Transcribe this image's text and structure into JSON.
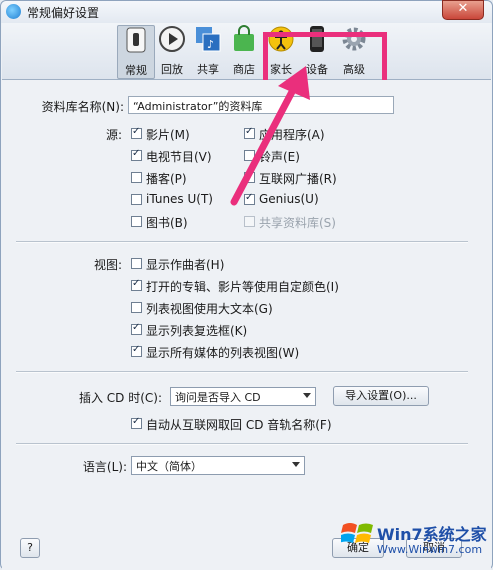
{
  "window": {
    "title": "常规偏好设置",
    "close_label": "✕"
  },
  "toolbar": {
    "items": [
      {
        "label": "常规",
        "icon": "general-switch-icon",
        "selected": true
      },
      {
        "label": "回放",
        "icon": "playback-icon"
      },
      {
        "label": "共享",
        "icon": "sharing-icon"
      },
      {
        "label": "商店",
        "icon": "store-bag-icon"
      },
      {
        "label": "家长",
        "icon": "parental-icon"
      },
      {
        "label": "设备",
        "icon": "device-icon"
      },
      {
        "label": "高级",
        "icon": "advanced-gear-icon"
      }
    ]
  },
  "library": {
    "label": "资料库名称(N):",
    "value": "“Administrator”的资料库"
  },
  "sources": {
    "label": "源:",
    "left": [
      {
        "label": "影片(M)",
        "checked": true
      },
      {
        "label": "电视节目(V)",
        "checked": true
      },
      {
        "label": "播客(P)",
        "checked": false
      },
      {
        "label": "iTunes U(T)",
        "checked": false
      },
      {
        "label": "图书(B)",
        "checked": false
      }
    ],
    "right": [
      {
        "label": "应用程序(A)",
        "checked": true
      },
      {
        "label": "铃声(E)",
        "checked": false
      },
      {
        "label": "互联网广播(R)",
        "checked": false
      },
      {
        "label": "Genius(U)",
        "checked": true
      },
      {
        "label": "共享资料库(S)",
        "checked": false,
        "disabled": true
      }
    ]
  },
  "views": {
    "label": "视图:",
    "items": [
      {
        "label": "显示作曲者(H)",
        "checked": false
      },
      {
        "label": "打开的专辑、影片等使用自定颜色(I)",
        "checked": true
      },
      {
        "label": "列表视图使用大文本(G)",
        "checked": false
      },
      {
        "label": "显示列表复选框(K)",
        "checked": true
      },
      {
        "label": "显示所有媒体的列表视图(W)",
        "checked": true
      }
    ]
  },
  "cd": {
    "label": "插入 CD 时(C):",
    "select_value": "询问是否导入 CD",
    "import_button": "导入设置(O)...",
    "auto_label": "自动从互联网取回 CD 音轨名称(F)",
    "auto_checked": true
  },
  "language": {
    "label": "语言(L):",
    "value": "中文（简体）"
  },
  "footer": {
    "help": "?",
    "ok": "确定",
    "cancel": "取消"
  },
  "watermark": {
    "brand": "Win7系统之家",
    "url": "Www.Winwin7.com"
  },
  "colors": {
    "highlight": "#ea2f7c",
    "accent": "#1f7fd2"
  }
}
